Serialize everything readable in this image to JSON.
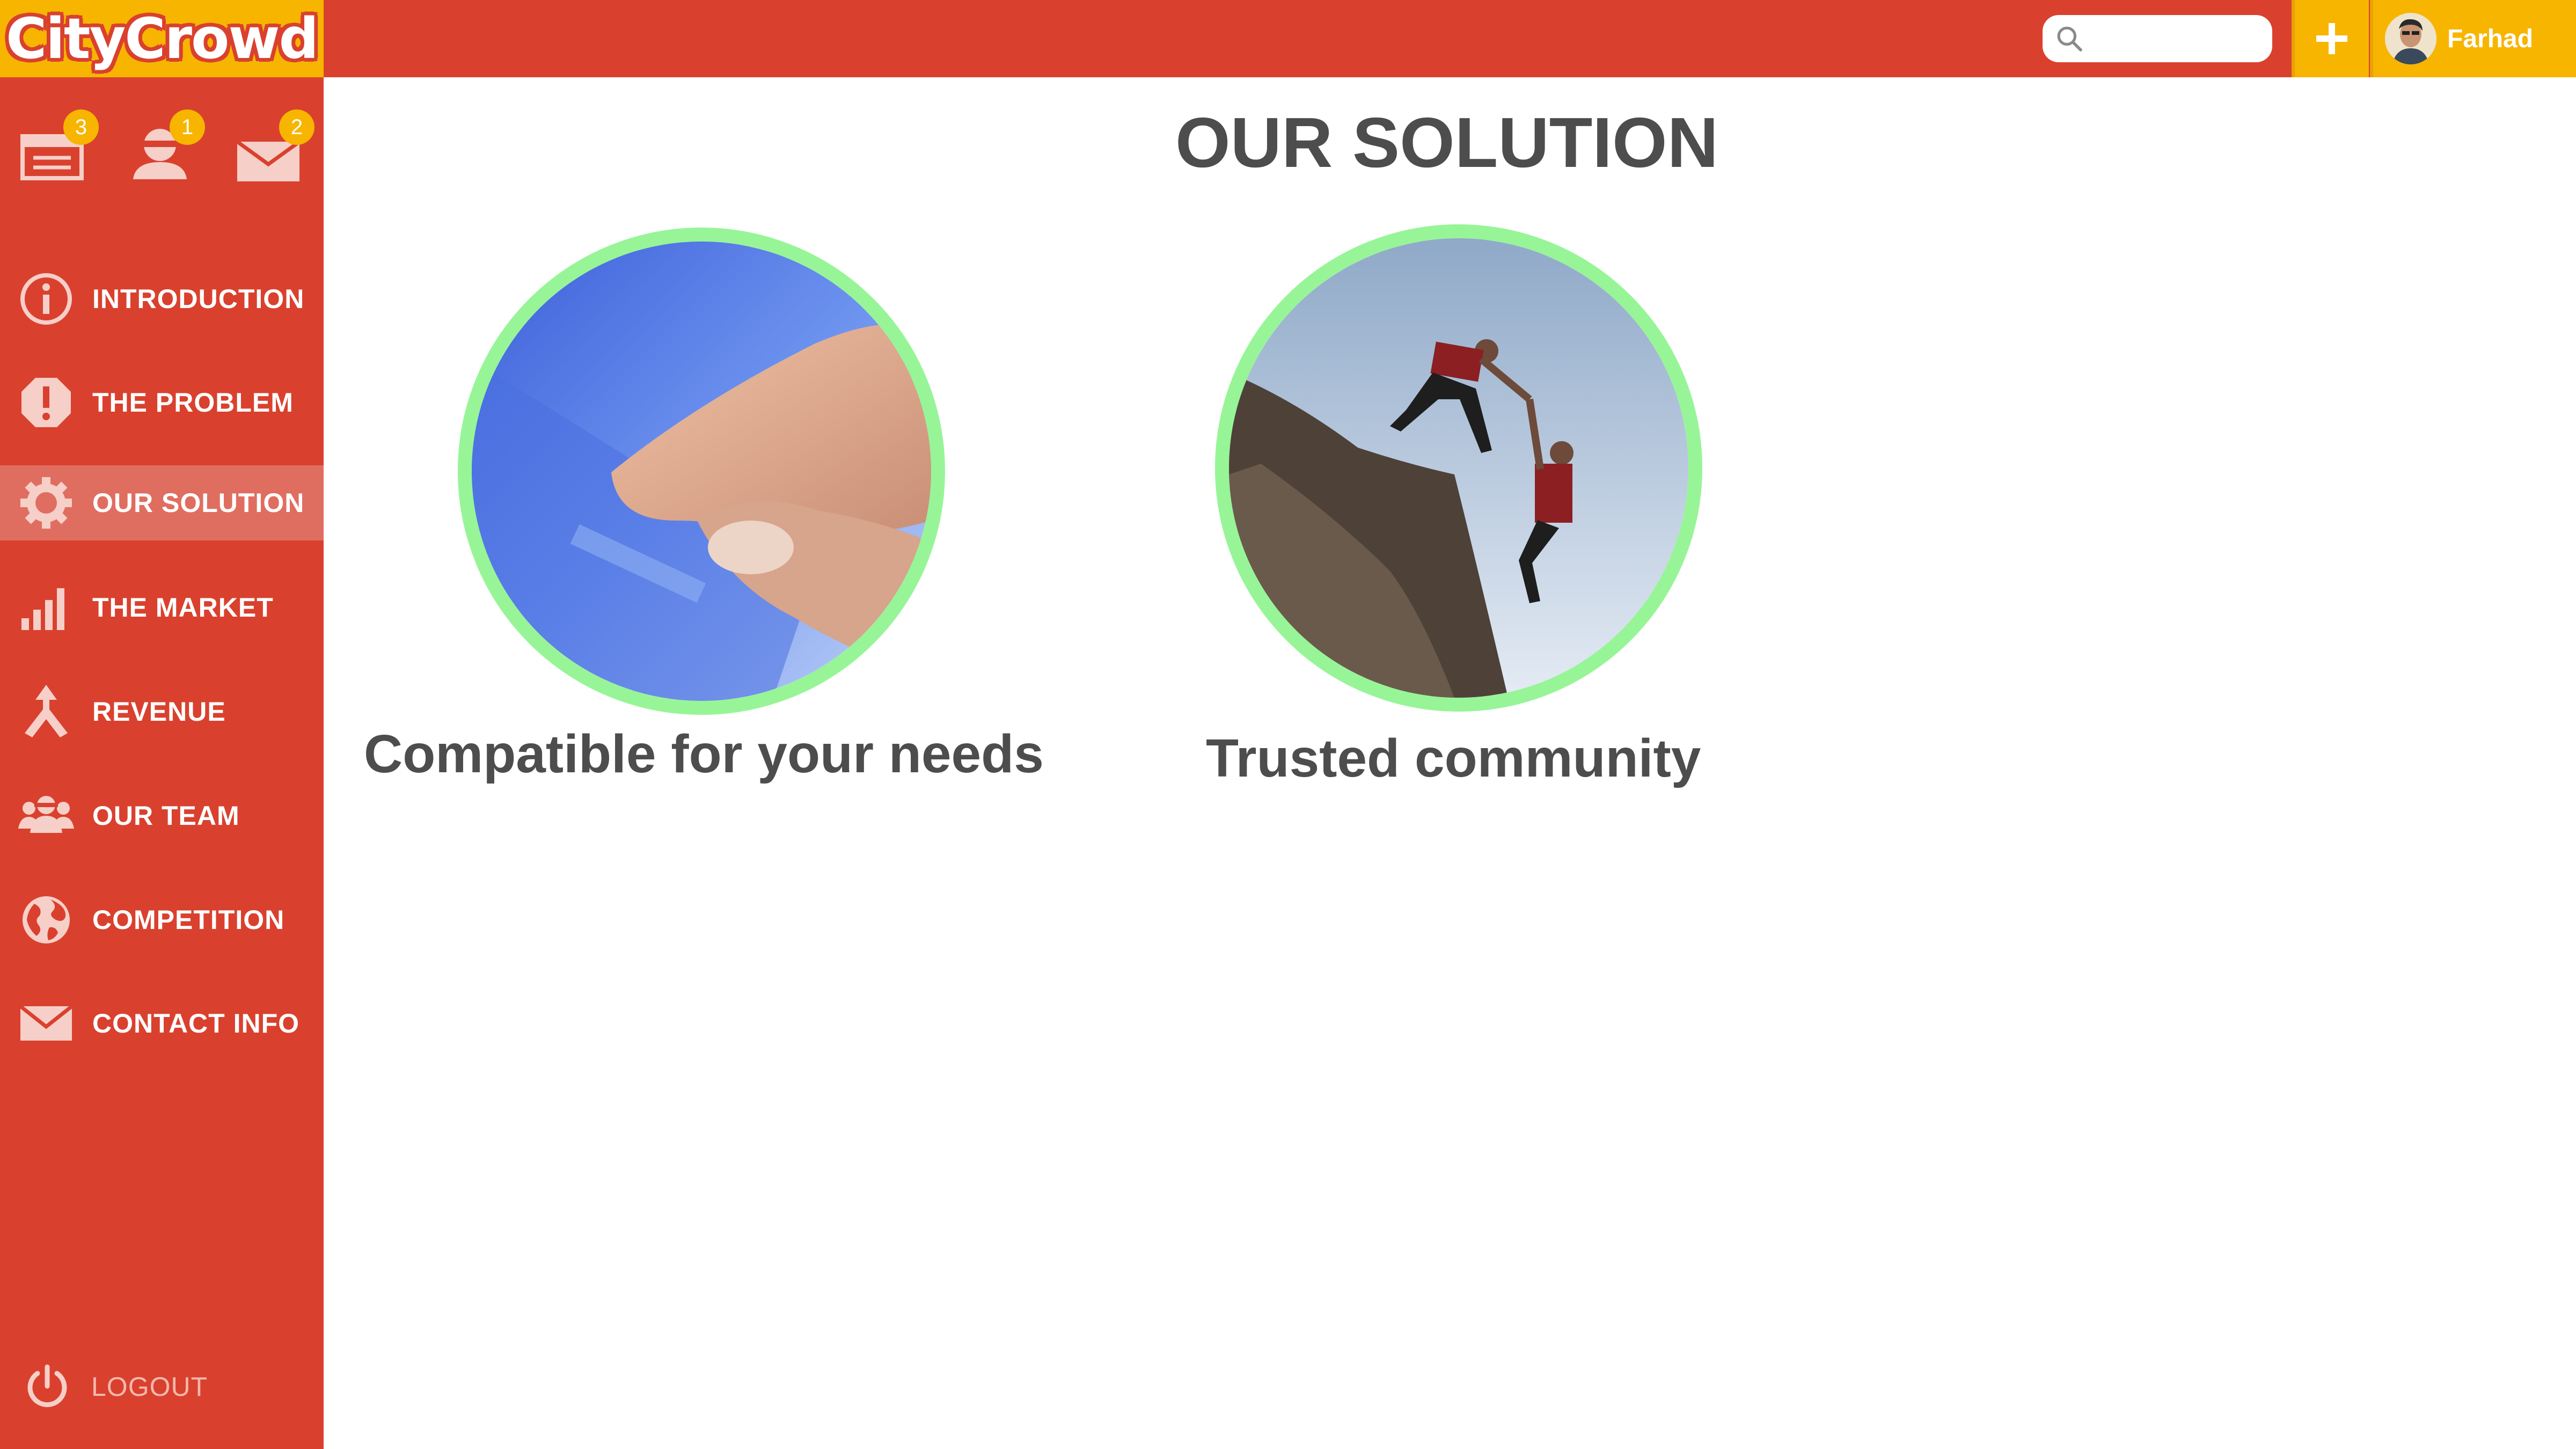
{
  "app": {
    "logo_text": "CityCrowd"
  },
  "header": {
    "search_placeholder": "",
    "add_label": "+",
    "user_name": "Farhad"
  },
  "notifications": [
    {
      "icon": "inbox-icon",
      "count": "3"
    },
    {
      "icon": "user-alert-icon",
      "count": "1"
    },
    {
      "icon": "mail-icon",
      "count": "2"
    }
  ],
  "sidebar": {
    "items": [
      {
        "label": "INTRODUCTION",
        "icon": "info-icon"
      },
      {
        "label": "THE PROBLEM",
        "icon": "alert-icon"
      },
      {
        "label": "OUR SOLUTION",
        "icon": "gear-icon",
        "active": true
      },
      {
        "label": "THE MARKET",
        "icon": "bar-chart-icon"
      },
      {
        "label": "REVENUE",
        "icon": "merge-arrow-icon"
      },
      {
        "label": "OUR TEAM",
        "icon": "team-icon"
      },
      {
        "label": "COMPETITION",
        "icon": "globe-icon"
      },
      {
        "label": "CONTACT INFO",
        "icon": "envelope-icon"
      }
    ],
    "logout_label": "LOGOUT"
  },
  "main": {
    "title": "OUR SOLUTION",
    "cards": [
      {
        "caption": "Compatible for your needs",
        "image": "finger-touching-tablet"
      },
      {
        "caption": "Trusted community",
        "image": "climbers-helping-hand"
      }
    ]
  },
  "colors": {
    "primary_red": "#d9412e",
    "accent_yellow": "#f7b500",
    "active_item": "#e06e60",
    "circle_border": "#97f597",
    "title_text": "#4d4d4d"
  }
}
